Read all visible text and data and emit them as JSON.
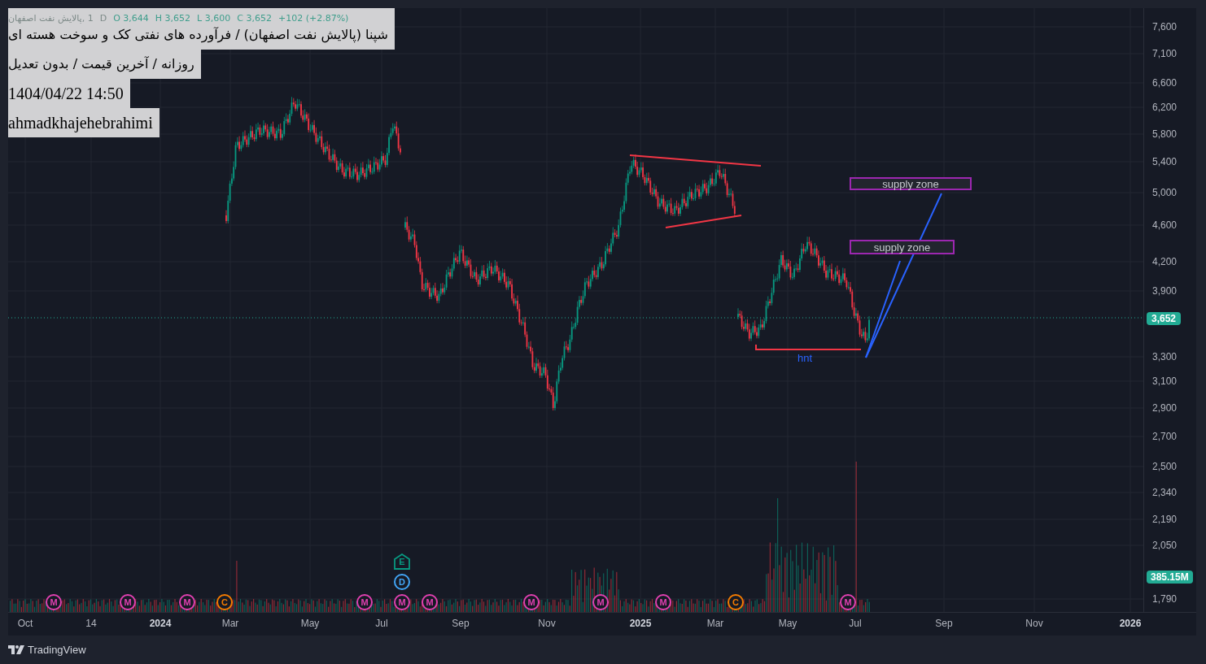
{
  "header": {
    "legend": {
      "symbol": "1 ,پالایش نفت اصفهان",
      "interval": "D",
      "ohlc": [
        {
          "label": "O",
          "value": "3,644"
        },
        {
          "label": "H",
          "value": "3,652"
        },
        {
          "label": "L",
          "value": "3,600"
        },
        {
          "label": "C",
          "value": "3,652"
        }
      ],
      "change": "+102 (+2.87%)"
    },
    "lines": [
      {
        "text": "شپنا (پالایش نفت اصفهان) / فرآورده های نفتی کک و سوخت هسته ای",
        "rtl": true
      },
      {
        "text": "روزانه / آخرین قیمت / بدون تعدیل",
        "rtl": true
      },
      {
        "text": "1404/04/22 14:50",
        "rtl": false
      },
      {
        "text": "ahmadkhajehebrahimi",
        "rtl": false
      }
    ]
  },
  "annotations": [
    {
      "kind": "zone",
      "text": "supply zone"
    },
    {
      "kind": "zone",
      "text": "supply zone"
    },
    {
      "kind": "label",
      "text": "hnt"
    }
  ],
  "events": [
    {
      "kind": "circle",
      "letter": "M",
      "color": "#e040b0"
    },
    {
      "kind": "circle",
      "letter": "M",
      "color": "#e040b0"
    },
    {
      "kind": "circle",
      "letter": "M",
      "color": "#e040b0"
    },
    {
      "kind": "circle",
      "letter": "C",
      "color": "#f57c00"
    },
    {
      "kind": "circle",
      "letter": "M",
      "color": "#e040b0"
    },
    {
      "kind": "pentagon",
      "letter": "E",
      "color": "#089981"
    },
    {
      "kind": "circle",
      "letter": "D",
      "color": "#42a5f5"
    },
    {
      "kind": "circle",
      "letter": "M",
      "color": "#e040b0"
    },
    {
      "kind": "circle",
      "letter": "M",
      "color": "#e040b0"
    },
    {
      "kind": "circle",
      "letter": "M",
      "color": "#e040b0"
    },
    {
      "kind": "circle",
      "letter": "M",
      "color": "#e040b0"
    },
    {
      "kind": "circle",
      "letter": "M",
      "color": "#e040b0"
    },
    {
      "kind": "circle",
      "letter": "C",
      "color": "#f57c00"
    },
    {
      "kind": "circle",
      "letter": "M",
      "color": "#e040b0"
    }
  ],
  "price_axis": {
    "labels": [
      "7,600",
      "7,100",
      "6,600",
      "6,200",
      "5,800",
      "5,400",
      "5,000",
      "4,600",
      "4,200",
      "3,900",
      "3,300",
      "3,100",
      "2,900",
      "2,700",
      "2,500",
      "2,340",
      "2,190",
      "2,050",
      "1,790"
    ],
    "last_price": "3,652",
    "volume": "385.15M"
  },
  "time_axis": [
    {
      "text": "Oct",
      "major": false
    },
    {
      "text": "14",
      "major": false
    },
    {
      "text": "2024",
      "major": true
    },
    {
      "text": "Mar",
      "major": false
    },
    {
      "text": "May",
      "major": false
    },
    {
      "text": "Jul",
      "major": false
    },
    {
      "text": "Sep",
      "major": false
    },
    {
      "text": "Nov",
      "major": false
    },
    {
      "text": "2025",
      "major": true
    },
    {
      "text": "Mar",
      "major": false
    },
    {
      "text": "May",
      "major": false
    },
    {
      "text": "Jul",
      "major": false
    },
    {
      "text": "Sep",
      "major": false
    },
    {
      "text": "Nov",
      "major": false
    },
    {
      "text": "2026",
      "major": true
    }
  ],
  "footer": {
    "brand": "TradingView"
  }
}
